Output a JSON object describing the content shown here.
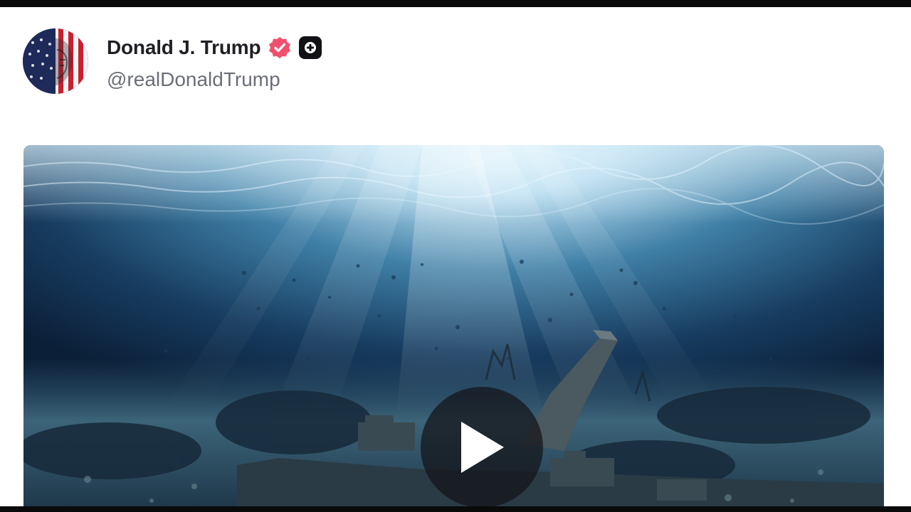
{
  "post": {
    "author": {
      "display_name": "Donald J. Trump",
      "handle": "@realDonaldTrump",
      "verified": true,
      "avatar_icon": "flag-face-avatar"
    },
    "badges": {
      "verified_icon": "verified-badge-icon",
      "verified_color": "#f0506e",
      "plus_icon": "plus-badge-icon",
      "plus_color": "#111216"
    },
    "media": {
      "type": "video",
      "scene": "underwater-shipwreck",
      "play_icon": "play-icon"
    }
  },
  "colors": {
    "frame_border": "#0a0a0a",
    "background": "#ffffff",
    "name_text": "#1f1f24",
    "handle_text": "#6b6e78",
    "water_deep": "#0b1f38",
    "water_light": "#a9d4ea"
  }
}
